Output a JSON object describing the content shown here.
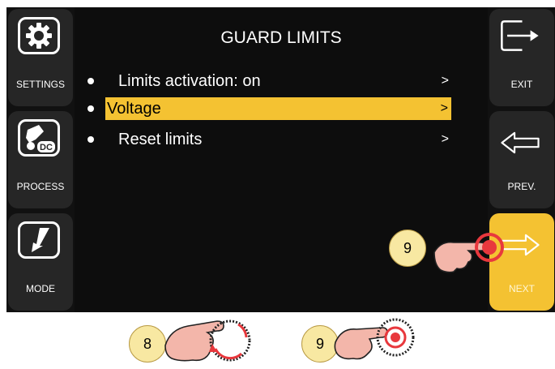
{
  "screen": {
    "title": "GUARD LIMITS",
    "menu": [
      {
        "label": "Limits activation: on",
        "arrow": ">",
        "selected": false
      },
      {
        "label": "Voltage",
        "arrow": ">",
        "selected": true
      },
      {
        "label": "Reset limits",
        "arrow": ">",
        "selected": false
      }
    ]
  },
  "left_buttons": [
    {
      "label": "SETTINGS",
      "icon": "gear-icon"
    },
    {
      "label": "PROCESS",
      "icon": "welding-torch-dc-icon",
      "icon_text": "DC"
    },
    {
      "label": "MODE",
      "icon": "torch-mode-icon"
    }
  ],
  "right_buttons": [
    {
      "label": "EXIT",
      "icon": "exit-arrow-icon"
    },
    {
      "label": "PREV.",
      "icon": "left-arrow-icon"
    },
    {
      "label": "NEXT",
      "icon": "right-arrow-icon",
      "active": true
    }
  ],
  "callouts": [
    {
      "number": "9",
      "description": "touch next button"
    },
    {
      "number": "8",
      "description": "rotate encoder knob"
    },
    {
      "number": "9",
      "description": "press encoder knob"
    }
  ],
  "colors": {
    "accent": "#f4c232",
    "background": "#0b0b0b",
    "button": "#262626",
    "badge": "#f8e8a2",
    "touch": "#e8383d"
  }
}
